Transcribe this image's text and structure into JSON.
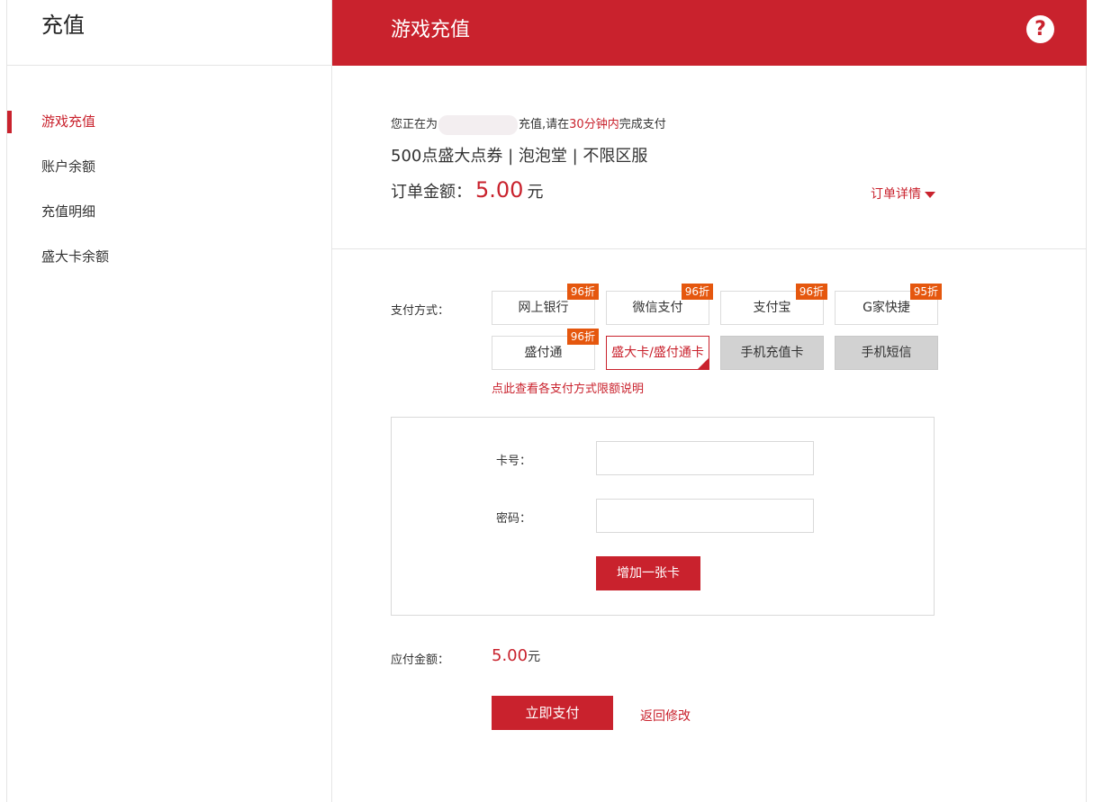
{
  "sidebar": {
    "title": "充值",
    "items": [
      {
        "label": "游戏充值",
        "active": true
      },
      {
        "label": "账户余额",
        "active": false
      },
      {
        "label": "充值明细",
        "active": false
      },
      {
        "label": "盛大卡余额",
        "active": false
      }
    ]
  },
  "header": {
    "title": "游戏充值",
    "help_icon": "question-circle-icon",
    "help_glyph": "?"
  },
  "order": {
    "intro_prefix": "您正在为",
    "intro_mid": "充值,请在",
    "intro_time": "30分钟内",
    "intro_suffix": "完成支付",
    "product": "500点盛大点券 | 泡泡堂 | 不限区服",
    "amount_label": "订单金额：",
    "amount_value": "5.00",
    "amount_unit": "元",
    "detail_link": "订单详情"
  },
  "payment": {
    "label": "支付方式：",
    "methods": [
      {
        "label": "网上银行",
        "badge": "96折"
      },
      {
        "label": "微信支付",
        "badge": "96折"
      },
      {
        "label": "支付宝",
        "badge": "96折"
      },
      {
        "label": "G家快捷",
        "badge": "95折"
      },
      {
        "label": "盛付通",
        "badge": "96折"
      },
      {
        "label": "盛大卡/盛付通卡",
        "badge": "",
        "selected": true
      },
      {
        "label": "手机充值卡",
        "badge": "",
        "disabled": true
      },
      {
        "label": "手机短信",
        "badge": "",
        "disabled": true
      }
    ],
    "limit_link": "点此查看各支付方式限额说明"
  },
  "card_form": {
    "card_label": "卡号：",
    "card_value": "",
    "password_label": "密码：",
    "password_value": "",
    "add_button": "增加一张卡"
  },
  "summary": {
    "label": "应付金额：",
    "value": "5.00",
    "unit": "元",
    "pay_button": "立即支付",
    "back_link": "返回修改"
  },
  "colors": {
    "accent": "#c9222d",
    "badge": "#e5570e",
    "disabled": "#d2d2d2"
  }
}
